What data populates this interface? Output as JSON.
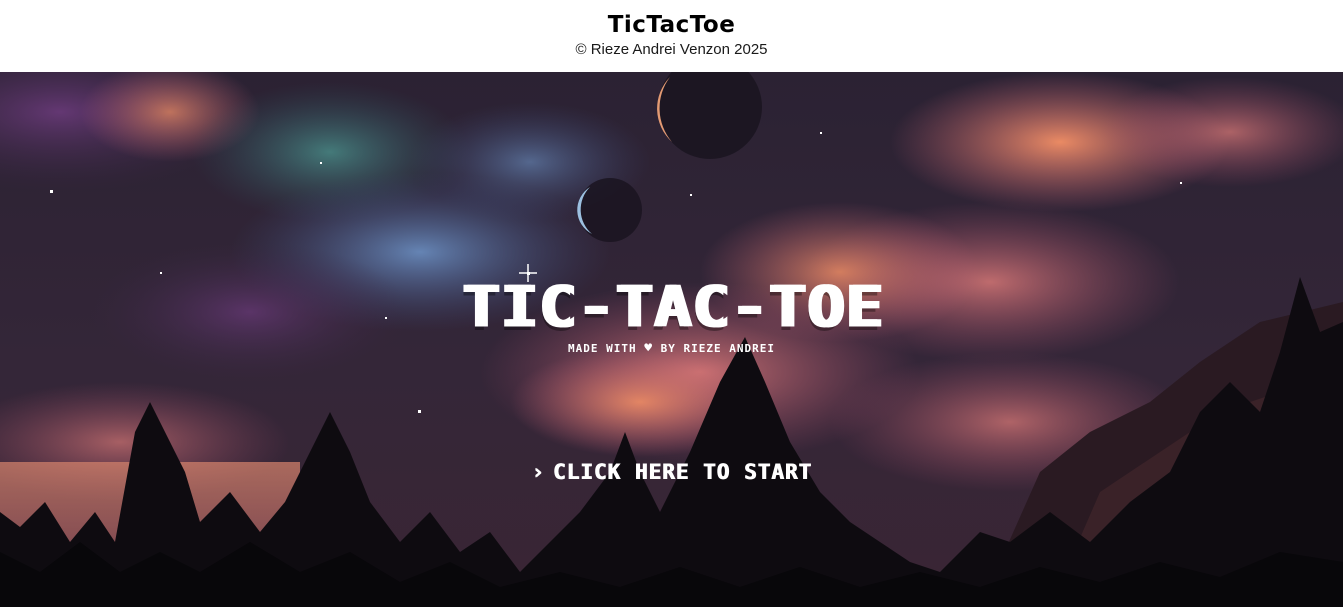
{
  "header": {
    "title": "TicTacToe",
    "copyright": "© Rieze Andrei Venzon 2025"
  },
  "game": {
    "title": "TIC-TAC-TOE",
    "made_with_prefix": "MADE WITH",
    "heart": "♥",
    "made_with_suffix": "BY RIEZE ANDREI",
    "start_chevron": "›",
    "start_label": "CLICK HERE TO START"
  },
  "background": {
    "description_icon": "pixel-night-sky-forest-background",
    "colors": {
      "sky_dark": "#2a2234",
      "sky_purple": "#4b2f59",
      "cloud_pink": "#c96a7c",
      "cloud_orange": "#f08a64",
      "cloud_blue": "#5b7fb0",
      "forest": "#0d0b0f"
    }
  }
}
